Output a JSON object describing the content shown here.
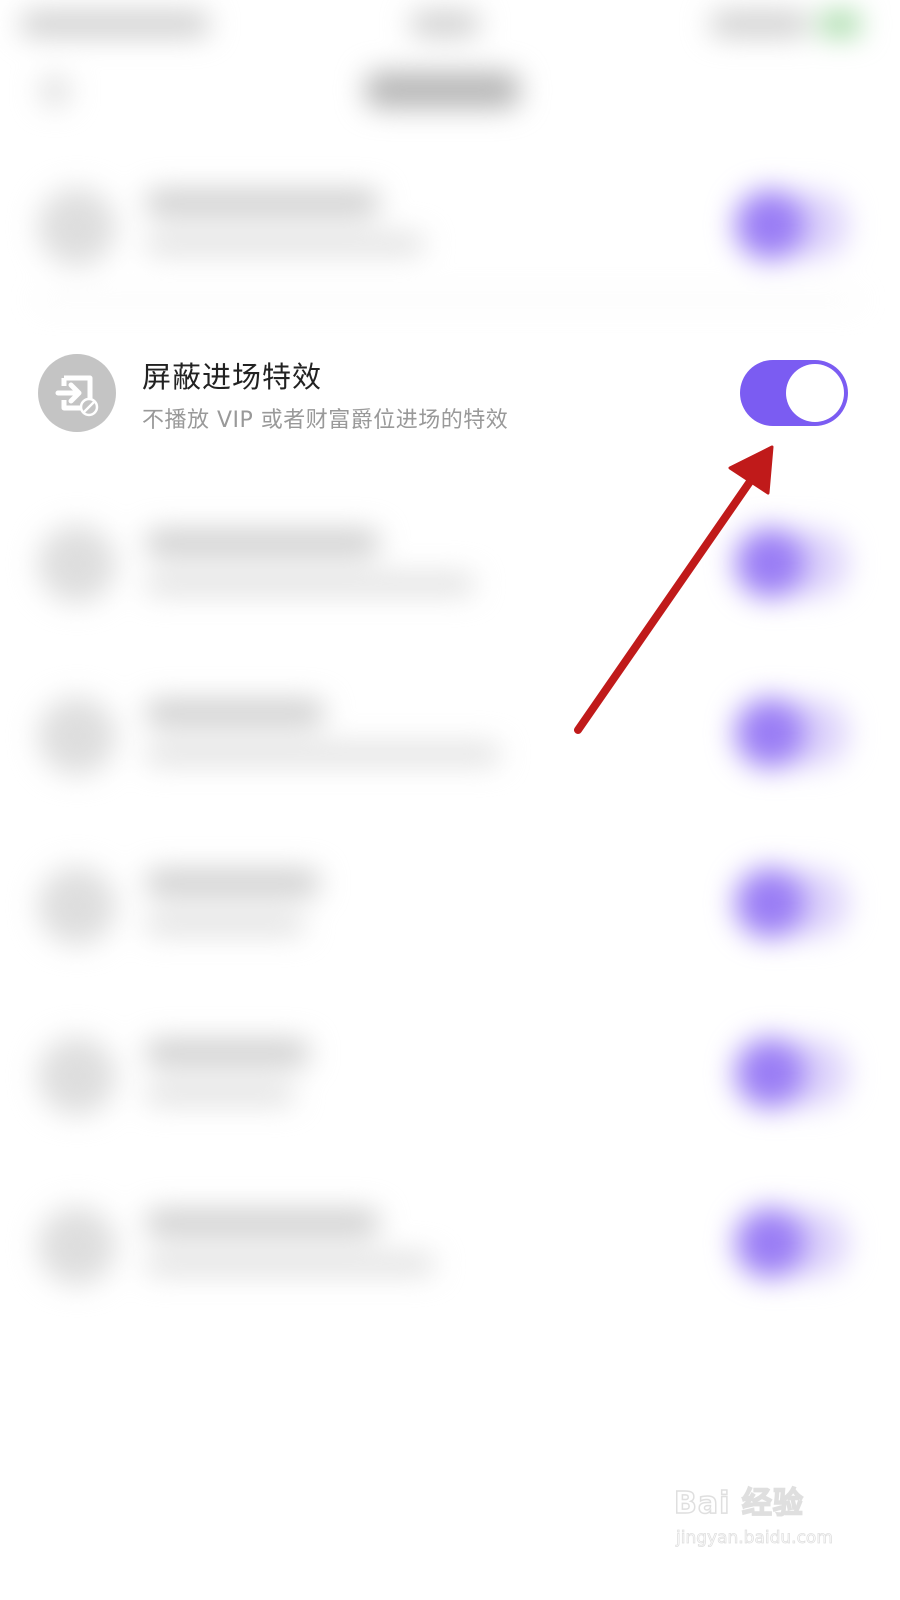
{
  "setting_row": {
    "title": "屏蔽进场特效",
    "subtitle": "不播放 VIP 或者财富爵位进场的特效",
    "icon": "exit-arrow-icon",
    "toggle_on": true
  },
  "colors": {
    "toggle_on": "#7b5cf2",
    "icon_bg": "#c4c4c4",
    "title": "#222222",
    "subtitle": "#999999",
    "annotation_arrow": "#c01a1a"
  },
  "watermark": {
    "brand": "Bai 经验",
    "url": "jingyan.baidu.com"
  }
}
